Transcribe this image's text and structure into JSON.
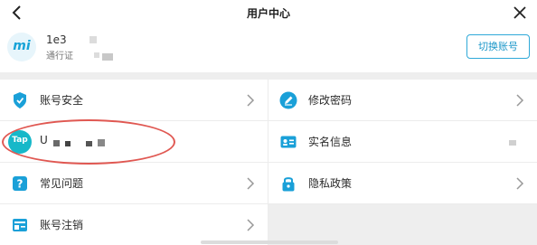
{
  "header": {
    "title": "用户中心",
    "back_icon": "chevron-left-icon",
    "close_icon": "close-icon"
  },
  "account": {
    "logo_text": "mi",
    "name_partial": "1e3",
    "subtitle_partial": "通行证",
    "switch_button": "切换账号"
  },
  "menu": {
    "left": [
      {
        "label": "账号安全",
        "icon": "shield-icon",
        "color": "#1aa0d8"
      },
      {
        "label": "U",
        "icon": "taptap-icon",
        "color": "#17b8c9"
      },
      {
        "label": "常见问题",
        "icon": "help-icon",
        "color": "#1aa0d8"
      },
      {
        "label": "账号注销",
        "icon": "account-close-icon",
        "color": "#1aa0d8"
      }
    ],
    "right": [
      {
        "label": "修改密码",
        "icon": "pencil-icon",
        "color": "#1aa0d8"
      },
      {
        "label": "实名信息",
        "icon": "id-card-icon",
        "color": "#1aa0d8"
      },
      {
        "label": "隐私政策",
        "icon": "lock-icon",
        "color": "#1aa0d8"
      }
    ]
  },
  "taptap_logo_text": "Tap",
  "annotation_color": "#e05852"
}
